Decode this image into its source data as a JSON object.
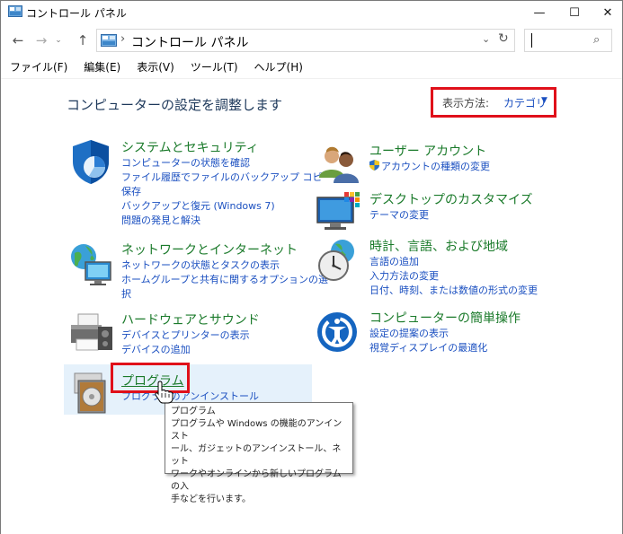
{
  "window": {
    "title": "コントロール パネル",
    "minimize": "—",
    "maximize": "☐",
    "close": "✕"
  },
  "nav": {
    "back": "←",
    "forward": "→",
    "recent": "⌄",
    "up": "↑",
    "breadcrumb_separator": "›",
    "breadcrumb": "コントロール パネル",
    "address_dropdown": "⌄",
    "refresh": "↻",
    "search_icon": "⌕"
  },
  "menu": [
    "ファイル(F)",
    "編集(E)",
    "表示(V)",
    "ツール(T)",
    "ヘルプ(H)"
  ],
  "heading": "コンピューターの設定を調整します",
  "view_by": {
    "label": "表示方法:",
    "value": "カテゴリ",
    "arrow": "▼"
  },
  "categories": {
    "system": {
      "title": "システムとセキュリティ",
      "links": [
        "コンピューターの状態を確認",
        "ファイル履歴でファイルのバックアップ コピーを",
        "保存",
        "バックアップと復元 (Windows 7)",
        "問題の発見と解決"
      ]
    },
    "network": {
      "title": "ネットワークとインターネット",
      "links": [
        "ネットワークの状態とタスクの表示",
        "ホームグループと共有に関するオプションの選",
        "択"
      ]
    },
    "hardware": {
      "title": "ハードウェアとサウンド",
      "links": [
        "デバイスとプリンターの表示",
        "デバイスの追加"
      ]
    },
    "programs": {
      "title": "プログラム",
      "links": [
        "プログラムのアンインストール"
      ]
    },
    "user": {
      "title": "ユーザー アカウント",
      "links": [
        "アカウントの種類の変更"
      ]
    },
    "desktop": {
      "title": "デスクトップのカスタマイズ",
      "links": [
        "テーマの変更"
      ]
    },
    "clock": {
      "title": "時計、言語、および地域",
      "links": [
        "言語の追加",
        "入力方法の変更",
        "日付、時刻、または数値の形式の変更"
      ]
    },
    "ease": {
      "title": "コンピューターの簡単操作",
      "links": [
        "設定の提案の表示",
        "視覚ディスプレイの最適化"
      ]
    }
  },
  "tooltip": {
    "title": "プログラム",
    "lines": [
      "プログラムや Windows の機能のアンインスト",
      "ール、ガジェットのアンインストール、ネット",
      "ワークやオンラインから新しいプログラムの入",
      "手などを行います。"
    ]
  },
  "colors": {
    "category_title": "#1a7a2a",
    "link": "#1a4fc0",
    "highlight_box": "#e0101a",
    "hover_bg": "#e5f1fb"
  }
}
